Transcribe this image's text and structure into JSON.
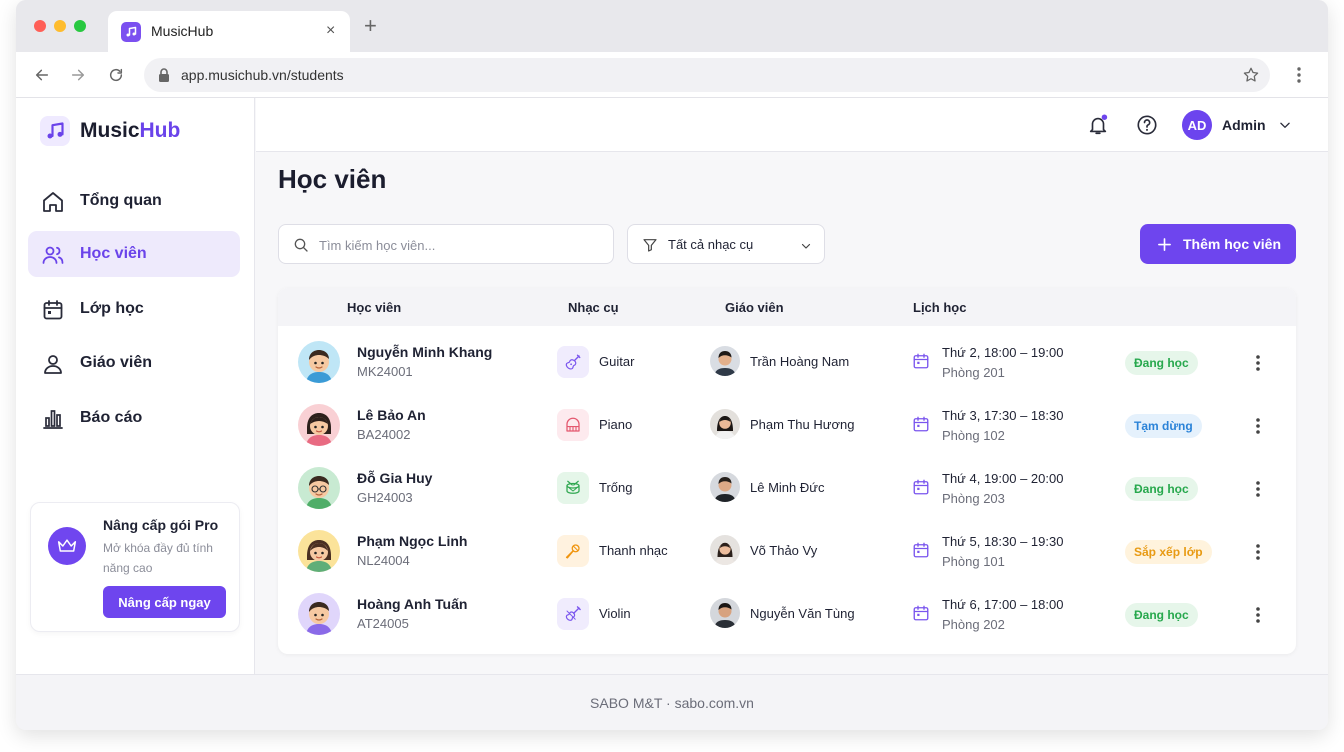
{
  "browser": {
    "tab_title": "MusicHub",
    "tab_close": "×",
    "new_tab": "+",
    "url": "app.musichub.vn/students"
  },
  "brand": {
    "part1": "Music",
    "part2": "Hub"
  },
  "sidebar": {
    "items": [
      {
        "label": "Tổng quan",
        "icon": "home-icon"
      },
      {
        "label": "Học viên",
        "icon": "users-icon",
        "active": true
      },
      {
        "label": "Lớp học",
        "icon": "calendar-icon"
      },
      {
        "label": "Giáo viên",
        "icon": "user-icon"
      },
      {
        "label": "Báo cáo",
        "icon": "bar-chart-icon"
      }
    ],
    "promo": {
      "title": "Nâng cấp gói Pro",
      "desc": "Mở khóa đầy đủ tính năng cao",
      "button": "Nâng cấp ngay"
    }
  },
  "topbar": {
    "avatar_initials": "AD",
    "user_name": "Admin"
  },
  "page": {
    "title": "Học viên",
    "search_placeholder": "Tìm kiếm học viên...",
    "filter_label": "Tất cả nhạc cụ",
    "add_button": "Thêm học viên"
  },
  "table": {
    "headers": [
      "Học viên",
      "Nhạc cụ",
      "Giáo viên",
      "Lịch học"
    ],
    "rows": [
      {
        "name": "Nguyễn Minh Khang",
        "code": "MK24001",
        "instrument": "Guitar",
        "teacher": "Trần Hoàng Nam",
        "time": "Thứ 2, 18:00 – 19:00",
        "room": "Phòng 201",
        "status": "Đang học"
      },
      {
        "name": "Lê Bảo An",
        "code": "BA24002",
        "instrument": "Piano",
        "teacher": "Phạm Thu Hương",
        "time": "Thứ 3, 17:30 – 18:30",
        "room": "Phòng 102",
        "status": "Tạm dừng"
      },
      {
        "name": "Đỗ Gia Huy",
        "code": "GH24003",
        "instrument": "Trống",
        "teacher": "Lê Minh Đức",
        "time": "Thứ 4, 19:00 – 20:00",
        "room": "Phòng 203",
        "status": "Đang học"
      },
      {
        "name": "Phạm Ngọc Linh",
        "code": "NL24004",
        "instrument": "Thanh nhạc",
        "teacher": "Võ Thảo Vy",
        "time": "Thứ 5, 18:30 – 19:30",
        "room": "Phòng 101",
        "status": "Sắp xếp lớp"
      },
      {
        "name": "Hoàng Anh Tuấn",
        "code": "AT24005",
        "instrument": "Violin",
        "teacher": "Nguyễn Văn Tùng",
        "time": "Thứ 6, 17:00 – 18:00",
        "room": "Phòng 202",
        "status": "Đang học"
      }
    ]
  },
  "footer": {
    "text": "SABO M&T · sabo.com.vn"
  },
  "colors": {
    "accent": "#6e45ee",
    "active_green": "#27a84d",
    "paused_blue": "#2b83d8",
    "pending_orange": "#e89a12"
  }
}
